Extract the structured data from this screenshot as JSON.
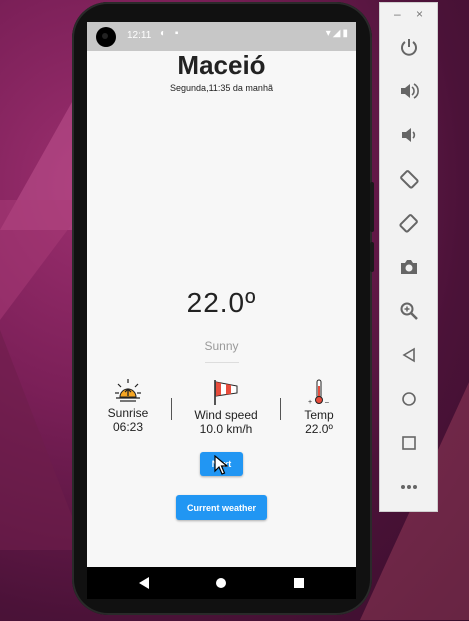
{
  "statusbar": {
    "time": "12:11",
    "left_icons": "◐ ▪",
    "right_icons": "▾◢▮"
  },
  "app": {
    "city": "Maceió",
    "datetime": "Segunda,11:35 da manhã",
    "temperature": "22.0º",
    "condition": "Sunny",
    "stats": [
      {
        "label": "Sunrise",
        "value": "06:23",
        "icon": "sunrise-icon"
      },
      {
        "label": "Wind speed",
        "value": "10.0 km/h",
        "icon": "windsock-icon"
      },
      {
        "label": "Temp",
        "value": "22.0º",
        "icon": "thermometer-icon"
      }
    ],
    "next_button": "Next",
    "current_weather_button": "Current weather"
  },
  "emulator_panel": {
    "minimize": "–",
    "close": "×",
    "tools": [
      "power-icon",
      "volume-up-icon",
      "volume-down-icon",
      "rotate-left-icon",
      "rotate-right-icon",
      "camera-icon",
      "zoom-icon",
      "back-icon",
      "home-icon",
      "overview-icon",
      "more-icon"
    ]
  },
  "colors": {
    "accent": "#2196f3",
    "statusbar": "#c7c7c7",
    "screen": "#f7f7f7"
  }
}
